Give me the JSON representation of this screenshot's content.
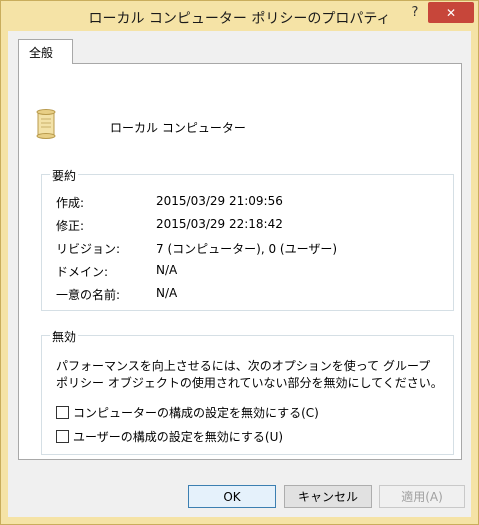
{
  "window": {
    "title": "ローカル コンピューター ポリシーのプロパティ",
    "help_icon": "?",
    "close_icon": "✕"
  },
  "tabs": [
    {
      "label": "全般"
    }
  ],
  "policy": {
    "name": "ローカル コンピューター",
    "icon": "scroll-icon"
  },
  "summary": {
    "title": "要約",
    "rows": [
      {
        "label": "作成:",
        "value": "2015/03/29 21:09:56"
      },
      {
        "label": "修正:",
        "value": "2015/03/29 22:18:42"
      },
      {
        "label": "リビジョン:",
        "value": "7 (コンピューター), 0 (ユーザー)"
      },
      {
        "label": "ドメイン:",
        "value": "N/A"
      },
      {
        "label": "一意の名前:",
        "value": "N/A"
      }
    ]
  },
  "disable": {
    "title": "無効",
    "description": "パフォーマンスを向上させるには、次のオプションを使って グループ ポリシー オブジェクトの使用されていない部分を無効にしてください。",
    "options": [
      {
        "label": "コンピューターの構成の設定を無効にする(C)",
        "checked": false
      },
      {
        "label": "ユーザーの構成の設定を無効にする(U)",
        "checked": false
      }
    ]
  },
  "buttons": {
    "ok": "OK",
    "cancel": "キャンセル",
    "apply": "適用(A)"
  }
}
